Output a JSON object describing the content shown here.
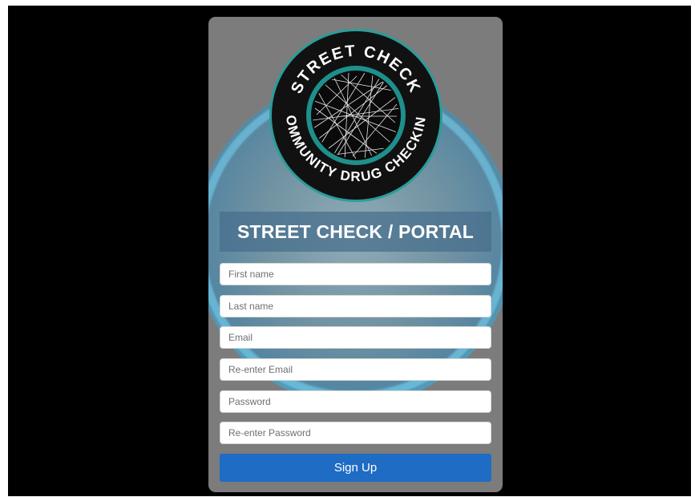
{
  "logo": {
    "top_text": "STREET CHECK",
    "bottom_text": "COMMUNITY DRUG CHECKING",
    "colors": {
      "ring": "#111111",
      "edge": "#2a9d9a",
      "text": "#ffffff"
    }
  },
  "banner": {
    "title": "STREET CHECK / PORTAL"
  },
  "form": {
    "first_name_placeholder": "First name",
    "last_name_placeholder": "Last name",
    "email_placeholder": "Email",
    "reenter_email_placeholder": "Re-enter Email",
    "password_placeholder": "Password",
    "reenter_password_placeholder": "Re-enter Password",
    "submit_label": "Sign Up"
  },
  "colors": {
    "page_bg": "#000000",
    "card_bg": "#7c7c7c",
    "button_bg": "#1e6cc4",
    "banner_bg": "#466e8c"
  }
}
